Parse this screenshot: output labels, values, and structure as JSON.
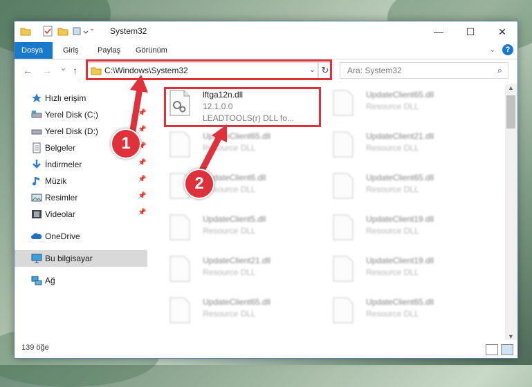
{
  "window": {
    "title": "System32",
    "controls": {
      "minimize": "—",
      "maximize": "☐",
      "close": "✕"
    }
  },
  "ribbon": {
    "tabs": [
      {
        "label": "Dosya",
        "active": true
      },
      {
        "label": "Giriş"
      },
      {
        "label": "Paylaş"
      },
      {
        "label": "Görünüm"
      }
    ],
    "help": "?"
  },
  "navigation": {
    "back": "←",
    "forward": "→",
    "recent": "⌄",
    "up": "↑",
    "address": "C:\\Windows\\System32",
    "refresh": "↻",
    "search_placeholder": "Ara: System32",
    "search_icon": "⌕"
  },
  "sidebar": {
    "items": [
      {
        "label": "Hızlı erişim",
        "icon": "star-icon"
      },
      {
        "label": "Yerel Disk (C:)",
        "icon": "drive-icon",
        "pinned": true
      },
      {
        "label": "Yerel Disk (D:)",
        "icon": "drive-icon",
        "pinned": true
      },
      {
        "label": "Belgeler",
        "icon": "documents-icon",
        "pinned": true
      },
      {
        "label": "İndirmeler",
        "icon": "downloads-icon",
        "pinned": true
      },
      {
        "label": "Müzik",
        "icon": "music-icon",
        "pinned": true
      },
      {
        "label": "Resimler",
        "icon": "pictures-icon",
        "pinned": true
      },
      {
        "label": "Videolar",
        "icon": "videos-icon",
        "pinned": true
      },
      {
        "label": "OneDrive",
        "icon": "cloud-icon"
      },
      {
        "label": "Bu bilgisayar",
        "icon": "computer-icon",
        "selected": true
      },
      {
        "label": "Ağ",
        "icon": "network-icon"
      }
    ],
    "pin_glyph": "📌"
  },
  "files": {
    "highlighted": {
      "name": "lftga12n.dll",
      "version": "12.1.0.0",
      "description": "LEADTOOLS(r) DLL fo..."
    },
    "left_column": [
      {
        "name": "UpdateClient65.dll",
        "type": "Resource DLL"
      },
      {
        "name": "UpdateClient6.dll",
        "type": "Resource DLL"
      },
      {
        "name": "UpdateClient5.dll",
        "type": "Resource DLL"
      },
      {
        "name": "UpdateClient21.dll",
        "type": "Resource DLL"
      },
      {
        "name": "UpdateClient65.dll",
        "type": "Resource DLL"
      }
    ],
    "right_column": [
      {
        "name": "UpdateClient65.dll",
        "type": "Resource DLL"
      },
      {
        "name": "UpdateClient21.dll",
        "type": "Resource DLL"
      },
      {
        "name": "UpdateClient65.dll",
        "type": "Resource DLL"
      },
      {
        "name": "UpdateClient19.dll",
        "type": "Resource DLL"
      },
      {
        "name": "UpdateClient19.dll",
        "type": "Resource DLL"
      },
      {
        "name": "UpdateClient65.dll",
        "type": "Resource DLL"
      }
    ]
  },
  "status": {
    "count": "139 öğe"
  },
  "annotations": {
    "step1": "1",
    "step2": "2",
    "color": "#e0313b"
  }
}
